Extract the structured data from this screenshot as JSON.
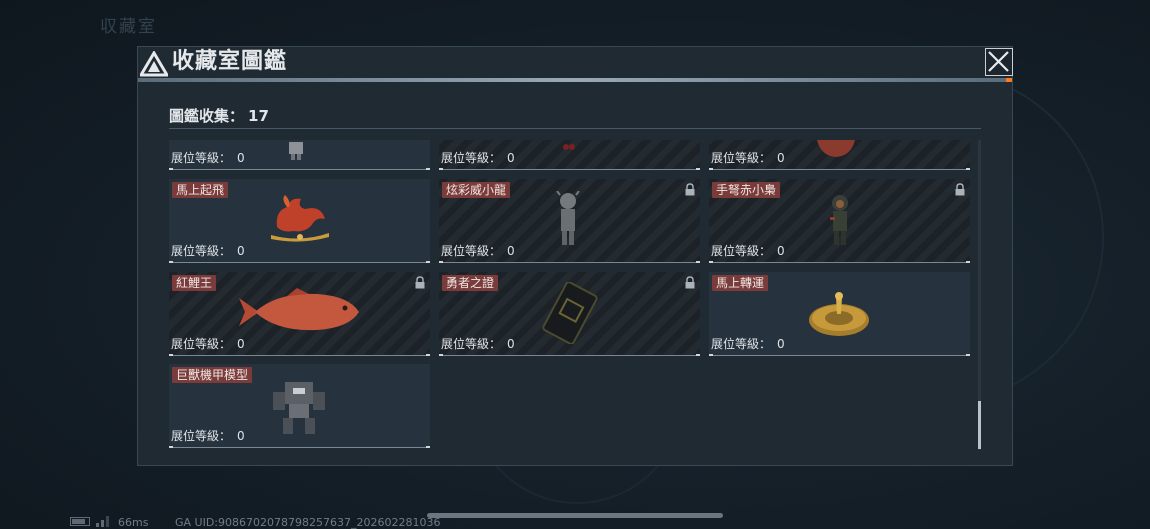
{
  "background": {
    "back_label": "‹",
    "title_label": "収藏室"
  },
  "dialog": {
    "title": "收藏室圖鑑",
    "collection_label": "圖鑑收集：",
    "collection_count": "17"
  },
  "level_label": "展位等級：",
  "cards": [
    {
      "name": "",
      "level": "0",
      "locked": false,
      "icon": "robot-figure-icon"
    },
    {
      "name": "",
      "level": "0",
      "locked": false,
      "icon": "figure-icon"
    },
    {
      "name": "",
      "level": "0",
      "locked": false,
      "icon": "vase-icon"
    },
    {
      "name": "馬上起飛",
      "level": "0",
      "locked": false,
      "icon": "horse-figure-icon"
    },
    {
      "name": "炫彩威小龍",
      "level": "0",
      "locked": true,
      "icon": "dragon-figure-icon"
    },
    {
      "name": "手弩赤小梟",
      "level": "0",
      "locked": true,
      "icon": "owl-figure-icon"
    },
    {
      "name": "紅鯉王",
      "level": "0",
      "locked": true,
      "icon": "carp-fish-icon"
    },
    {
      "name": "勇者之證",
      "level": "0",
      "locked": true,
      "icon": "badge-card-icon"
    },
    {
      "name": "馬上轉運",
      "level": "0",
      "locked": false,
      "icon": "compass-disc-icon"
    },
    {
      "name": "巨獸機甲模型",
      "level": "0",
      "locked": false,
      "icon": "mecha-model-icon"
    }
  ],
  "status": {
    "ping": "66ms",
    "uid": "GA UID:9086702078798257637_202602281036"
  },
  "colors": {
    "name_tag": "#7a3b3b",
    "accent": "#ff7a1a",
    "panel": "#1f2a33"
  }
}
